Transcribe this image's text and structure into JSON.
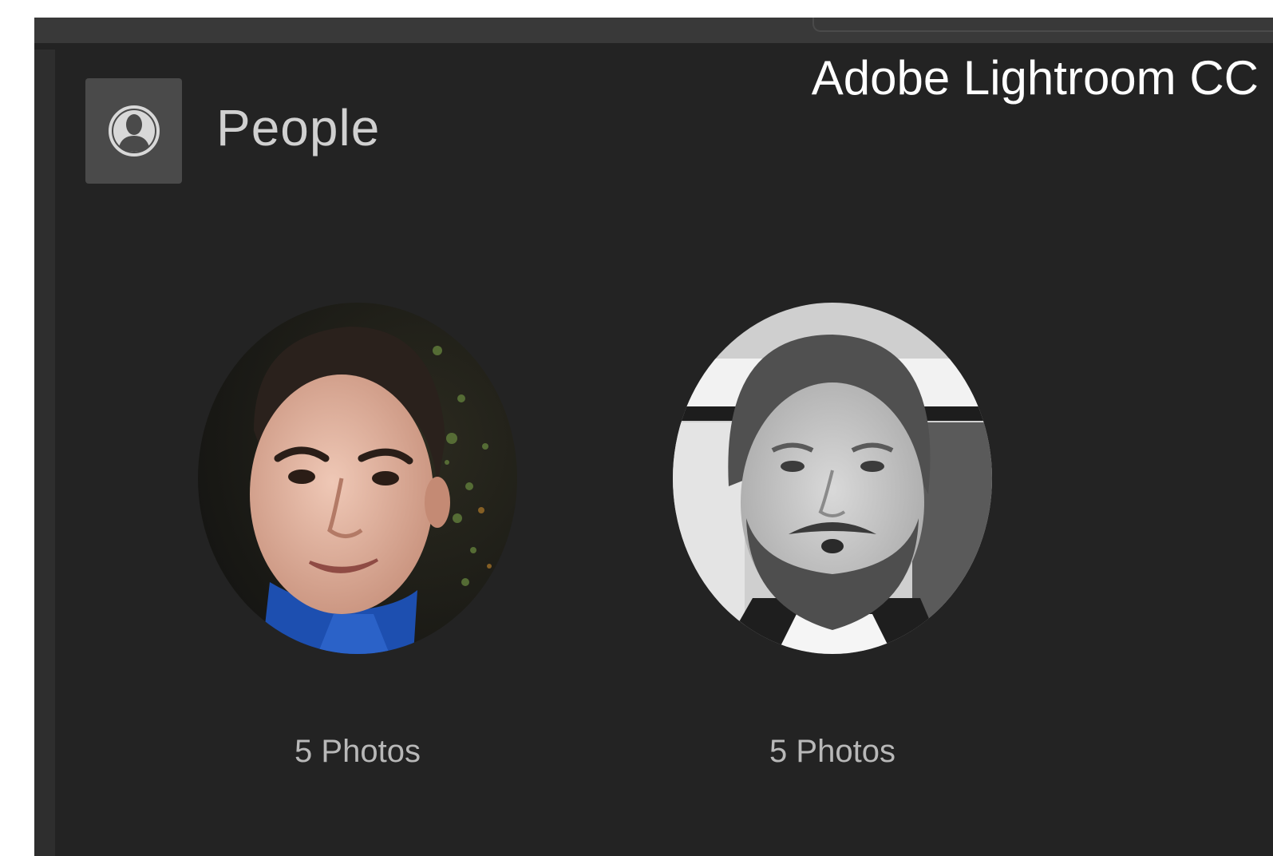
{
  "caption": "Adobe Lightroom CC",
  "section": {
    "title": "People",
    "icon": "person-icon"
  },
  "people": [
    {
      "photo_count_label": "5 Photos",
      "face": "person-face-photo"
    },
    {
      "photo_count_label": "5 Photos",
      "face": "person-face-photo"
    }
  ],
  "colors": {
    "background": "#232323",
    "topbar": "#393939",
    "icon_box": "#4a4a4a",
    "title_text": "#d0d0d0",
    "count_text": "#b8b8b8"
  }
}
